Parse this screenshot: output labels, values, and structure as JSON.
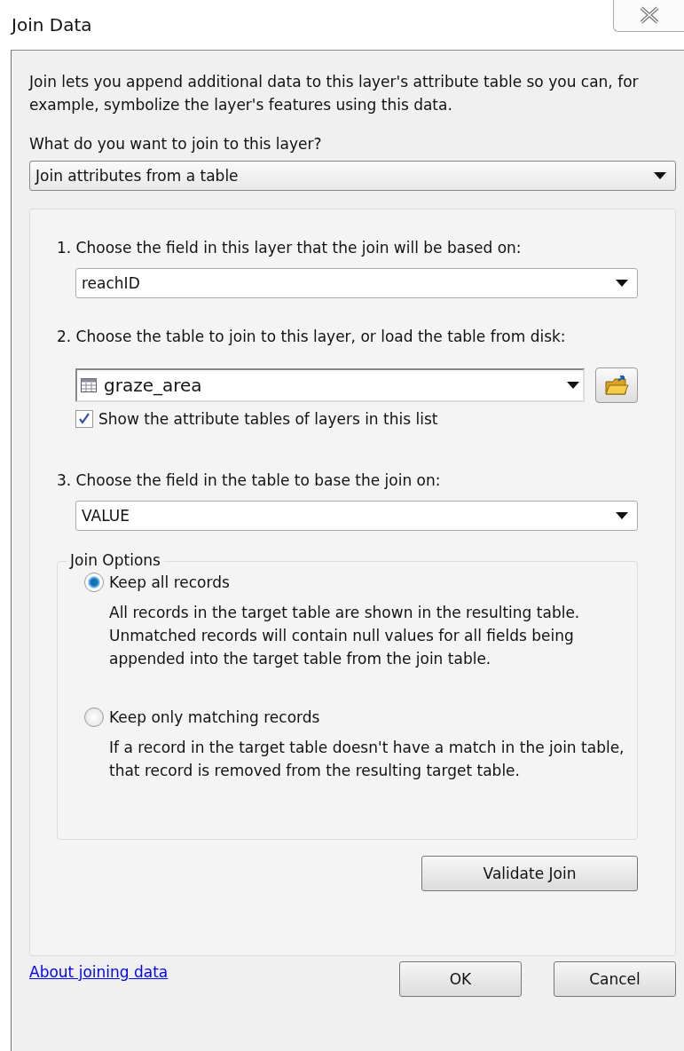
{
  "window": {
    "title": "Join Data"
  },
  "intro": "Join lets you append additional data to this layer's attribute table so you can, for example, symbolize the layer's features using this data.",
  "join_type": {
    "label": "What do you want to join to this layer?",
    "value": "Join attributes from a table"
  },
  "steps": [
    {
      "kind": "dropdown",
      "label": "1.  Choose the field in this layer that the join will be based on:",
      "value": "reachID"
    },
    {
      "kind": "table",
      "label": "2.  Choose the table to join to this layer, or load the table from disk:",
      "value": "graze_area",
      "checkbox": {
        "label": "Show the attribute tables of layers in this list",
        "checked": true
      }
    },
    {
      "kind": "dropdown",
      "label": "3.  Choose the field in the table to base the join on:",
      "value": "VALUE"
    }
  ],
  "join_options": {
    "title": "Join Options",
    "options": [
      {
        "label": "Keep all records",
        "selected": true,
        "description": "All records in the target table are shown in the resulting table. Unmatched records will contain null values for all fields being appended into the target table from the join table."
      },
      {
        "label": "Keep only matching records",
        "selected": false,
        "description": "If a record in the target table doesn't have a match in the join table, that record is removed from the resulting target table."
      }
    ]
  },
  "validate_button": "Validate Join",
  "help_link": "About joining data",
  "buttons": [
    "OK",
    "Cancel"
  ]
}
